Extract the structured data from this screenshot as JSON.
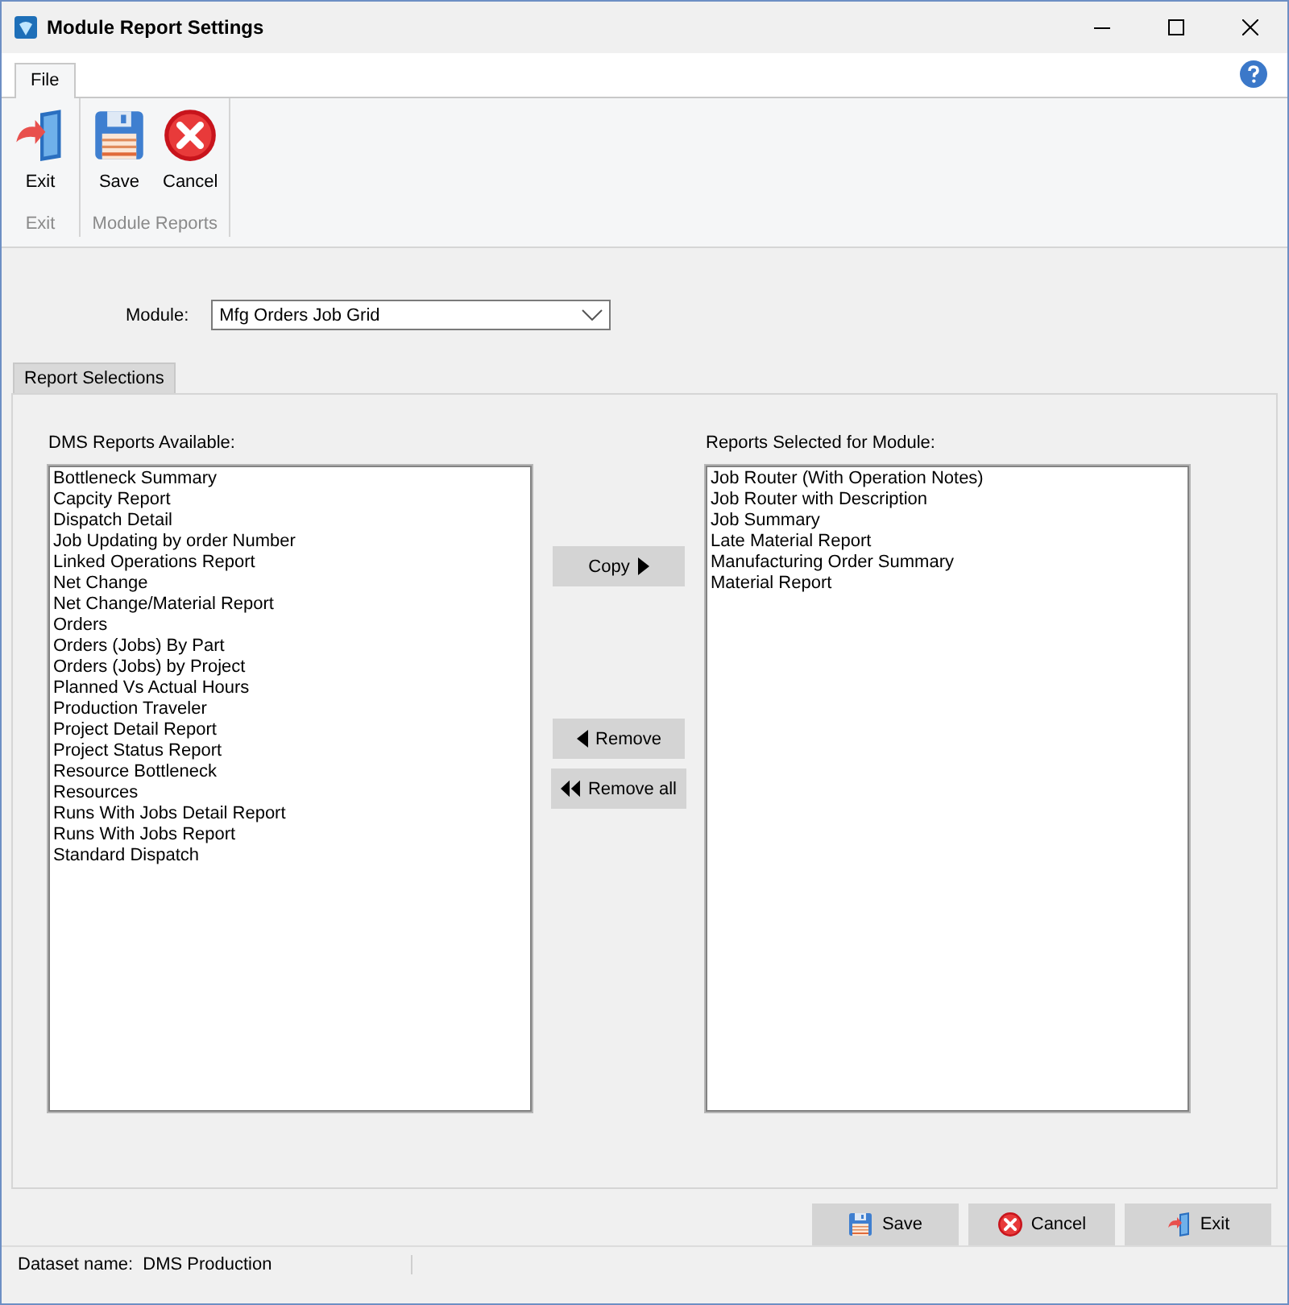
{
  "window": {
    "title": "Module Report Settings"
  },
  "ribbon": {
    "tabs": [
      {
        "label": "File",
        "selected": true
      }
    ],
    "groups": [
      {
        "label": "Exit",
        "buttons": [
          {
            "label": "Exit",
            "kind": "exit"
          }
        ]
      },
      {
        "label": "Module Reports",
        "buttons": [
          {
            "label": "Save",
            "kind": "save"
          },
          {
            "label": "Cancel",
            "kind": "cancel"
          }
        ]
      }
    ]
  },
  "module": {
    "label": "Module:",
    "value": "Mfg Orders Job Grid"
  },
  "page_tabs": [
    {
      "label": "Report Selections",
      "selected": true
    }
  ],
  "available": {
    "label": "DMS Reports Available:",
    "items": [
      "Bottleneck Summary",
      "Capcity Report",
      "Dispatch Detail",
      "Job Updating by order Number",
      "Linked Operations Report",
      "Net Change",
      "Net Change/Material Report",
      "Orders",
      "Orders (Jobs) By Part",
      "Orders (Jobs) by Project",
      "Planned Vs Actual Hours",
      "Production Traveler",
      "Project Detail Report",
      "Project Status Report",
      "Resource Bottleneck",
      "Resources",
      "Runs With Jobs Detail Report",
      "Runs With Jobs Report",
      "Standard Dispatch"
    ]
  },
  "transfer_buttons": [
    {
      "label": "Copy",
      "kind": "copy"
    },
    {
      "label": "Remove",
      "kind": "remove"
    },
    {
      "label": "Remove all",
      "kind": "remove_all"
    }
  ],
  "selected": {
    "label": "Reports Selected for Module:",
    "items": [
      "Job Router (With Operation Notes)",
      "Job Router with Description",
      "Job Summary",
      "Late Material Report",
      "Manufacturing Order Summary",
      "Material Report"
    ]
  },
  "footer_buttons": [
    {
      "label": "Save",
      "kind": "save"
    },
    {
      "label": "Cancel",
      "kind": "cancel"
    },
    {
      "label": "Exit",
      "kind": "exit"
    }
  ],
  "status_bar": {
    "text": "Dataset name:  DMS Production"
  }
}
